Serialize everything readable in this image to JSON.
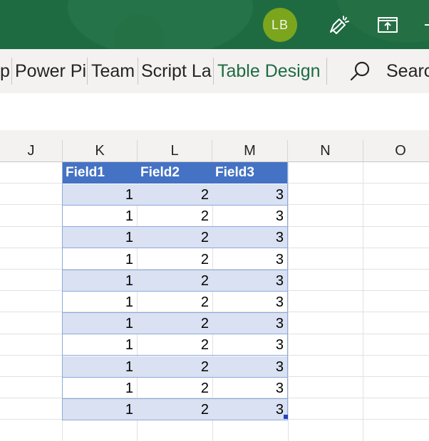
{
  "titlebar": {
    "avatar_initials": "LB",
    "icons": [
      "coach-marks-icon",
      "present-icon",
      "more-icon"
    ],
    "colors": {
      "background": "#1e6b41",
      "avatar": "#7aa51d"
    }
  },
  "ribbon": {
    "tabs": [
      {
        "label": "p"
      },
      {
        "label": "Power Pi"
      },
      {
        "label": "Team"
      },
      {
        "label": "Script La"
      },
      {
        "label": "Table Design",
        "active": true
      }
    ],
    "search_label": "Searc",
    "accent_color": "#1e6b41"
  },
  "sheet": {
    "columns": [
      "J",
      "K",
      "L",
      "M",
      "N",
      "O"
    ],
    "table": {
      "headers": [
        "Field1",
        "Field2",
        "Field3"
      ],
      "rows": [
        [
          "1",
          "2",
          "3"
        ],
        [
          "1",
          "2",
          "3"
        ],
        [
          "1",
          "2",
          "3"
        ],
        [
          "1",
          "2",
          "3"
        ],
        [
          "1",
          "2",
          "3"
        ],
        [
          "1",
          "2",
          "3"
        ],
        [
          "1",
          "2",
          "3"
        ],
        [
          "1",
          "2",
          "3"
        ],
        [
          "1",
          "2",
          "3"
        ],
        [
          "1",
          "2",
          "3"
        ],
        [
          "1",
          "2",
          "3"
        ]
      ],
      "header_color": "#4472c4",
      "band_color": "#d9e1f2"
    }
  }
}
